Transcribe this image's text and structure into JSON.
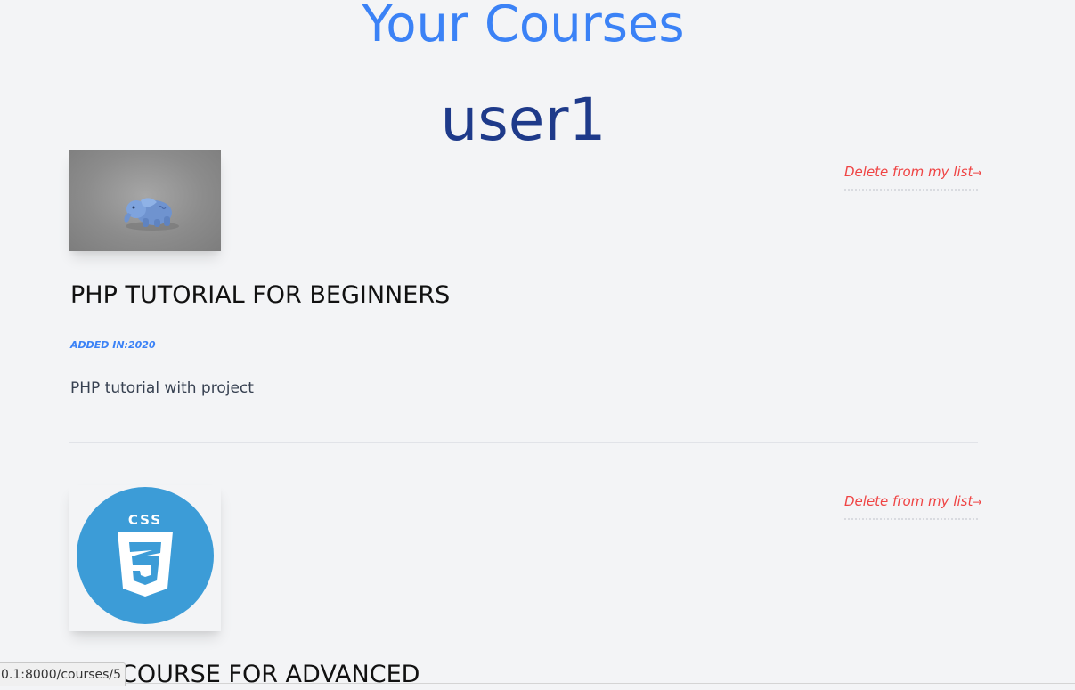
{
  "header": {
    "title": "Your Courses",
    "username": "user1"
  },
  "courses": [
    {
      "image_icon": "php-elephant-thumbnail",
      "delete_label": "Delete from my list",
      "delete_arrow": "→",
      "title": "PHP TUTORIAL FOR BEGINNERS",
      "added": "ADDED IN:2020",
      "description": "PHP tutorial with project"
    },
    {
      "image_icon": "css3-logo-thumbnail",
      "delete_label": "Delete from my list",
      "delete_arrow": "→",
      "title": "COURSE FOR ADVANCED"
    }
  ],
  "status_bar": {
    "url": "0.1:8000/courses/5"
  },
  "colors": {
    "accent": "#3b82f6",
    "heading_dark": "#1e3a8a",
    "delete": "#ef4444",
    "css_badge": "#3c9cd7"
  }
}
